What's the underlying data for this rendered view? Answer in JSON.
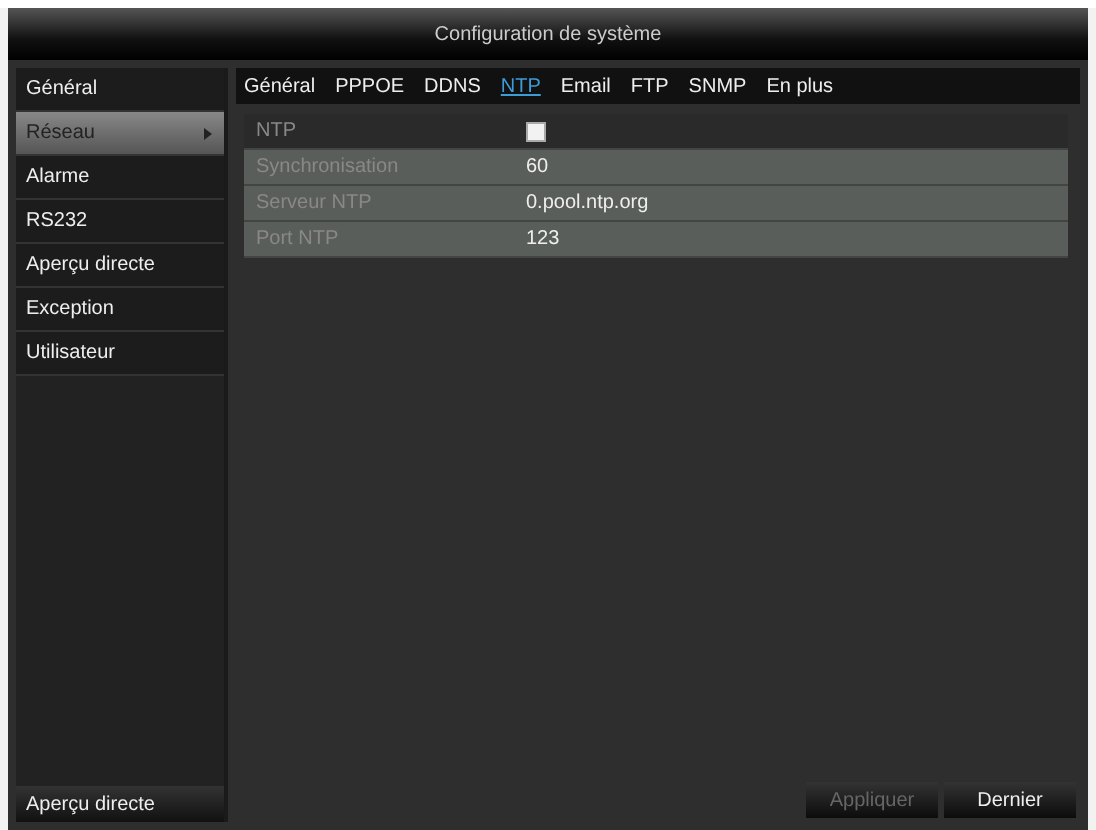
{
  "window": {
    "title": "Configuration de système"
  },
  "sidebar": {
    "items": [
      {
        "label": "Général",
        "selected": false
      },
      {
        "label": "Réseau",
        "selected": true
      },
      {
        "label": "Alarme",
        "selected": false
      },
      {
        "label": "RS232",
        "selected": false
      },
      {
        "label": "Aperçu directe",
        "selected": false
      },
      {
        "label": "Exception",
        "selected": false
      },
      {
        "label": "Utilisateur",
        "selected": false
      }
    ],
    "footer": "Aperçu directe"
  },
  "tabs": [
    {
      "label": "Général",
      "selected": false
    },
    {
      "label": "PPPOE",
      "selected": false
    },
    {
      "label": "DDNS",
      "selected": false
    },
    {
      "label": "NTP",
      "selected": true
    },
    {
      "label": "Email",
      "selected": false
    },
    {
      "label": "FTP",
      "selected": false
    },
    {
      "label": "SNMP",
      "selected": false
    },
    {
      "label": "En plus",
      "selected": false
    }
  ],
  "settings": [
    {
      "kind": "checkbox",
      "label": "NTP",
      "checked": false
    },
    {
      "kind": "text",
      "label": "Synchronisation",
      "value": "60"
    },
    {
      "kind": "text",
      "label": "Serveur NTP",
      "value": "0.pool.ntp.org"
    },
    {
      "kind": "text",
      "label": "Port NTP",
      "value": "123"
    }
  ],
  "buttons": [
    {
      "label": "Appliquer",
      "disabled": true
    },
    {
      "label": "Dernier",
      "disabled": false
    }
  ]
}
